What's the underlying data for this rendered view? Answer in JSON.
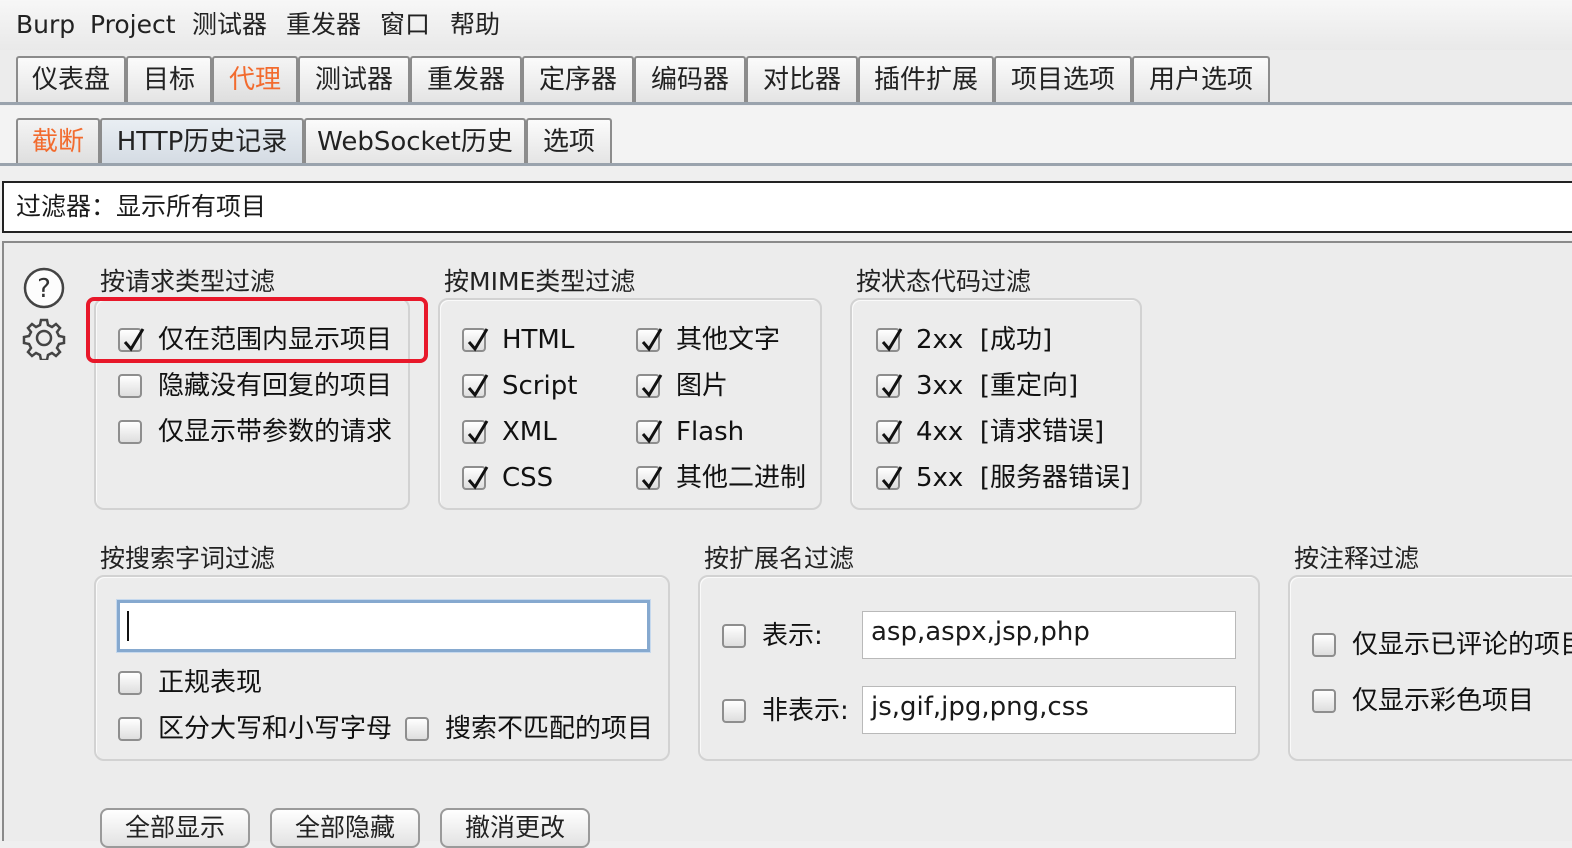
{
  "menu": [
    "Burp",
    "Project",
    "测试器",
    "重发器",
    "窗口",
    "帮助"
  ],
  "main_tabs": [
    "仪表盘",
    "目标",
    "代理",
    "测试器",
    "重发器",
    "定序器",
    "编码器",
    "对比器",
    "插件扩展",
    "项目选项",
    "用户选项"
  ],
  "active_main_tab": "代理",
  "sub_tabs": [
    "截断",
    "HTTP历史记录",
    "WebSocket历史",
    "选项"
  ],
  "active_sub_tab": "截断",
  "selected_sub_tab": "HTTP历史记录",
  "filter_bar": {
    "text": "过滤器：显示所有项目"
  },
  "request_type_filter": {
    "title": "按请求类型过滤",
    "options": [
      {
        "label": "仅在范围内显示项目",
        "checked": true
      },
      {
        "label": "隐藏没有回复的项目",
        "checked": false
      },
      {
        "label": "仅显示带参数的请求",
        "checked": false
      }
    ]
  },
  "mime_filter": {
    "title": "按MIME类型过滤",
    "options": [
      {
        "label": "HTML",
        "checked": true
      },
      {
        "label": "其他文字",
        "checked": true
      },
      {
        "label": "Script",
        "checked": true
      },
      {
        "label": "图片",
        "checked": true
      },
      {
        "label": "XML",
        "checked": true
      },
      {
        "label": "Flash",
        "checked": true
      },
      {
        "label": "CSS",
        "checked": true
      },
      {
        "label": "其他二进制",
        "checked": true
      }
    ]
  },
  "status_filter": {
    "title": "按状态代码过滤",
    "options": [
      {
        "label": "2xx  [成功]",
        "checked": true
      },
      {
        "label": "3xx  [重定向]",
        "checked": true
      },
      {
        "label": "4xx  [请求错误]",
        "checked": true
      },
      {
        "label": "5xx  [服务器错误]",
        "checked": true
      }
    ]
  },
  "search_filter": {
    "title": "按搜索字词过滤",
    "value": "",
    "options": [
      {
        "label": "正规表现",
        "checked": false
      },
      {
        "label": "区分大写和小写字母",
        "checked": false
      },
      {
        "label": "搜索不匹配的项目",
        "checked": false
      }
    ]
  },
  "extension_filter": {
    "title": "按扩展名过滤",
    "show": {
      "label": "表示:",
      "checked": false,
      "value": "asp,aspx,jsp,php"
    },
    "hide": {
      "label": "非表示:",
      "checked": false,
      "value": "js,gif,jpg,png,css"
    }
  },
  "annotation_filter": {
    "title": "按注释过滤",
    "options": [
      {
        "label": "仅显示已评论的项目",
        "checked": false
      },
      {
        "label": "仅显示彩色项目",
        "checked": false
      }
    ]
  },
  "bottom_buttons": [
    "全部显示",
    "全部隐藏",
    "撤消更改"
  ],
  "colors": {
    "accent": "#f26b2e",
    "highlight": "#e8182a",
    "focus": "#86a9cf"
  },
  "icons": [
    "help-icon",
    "gear-icon",
    "checkmark-icon"
  ]
}
